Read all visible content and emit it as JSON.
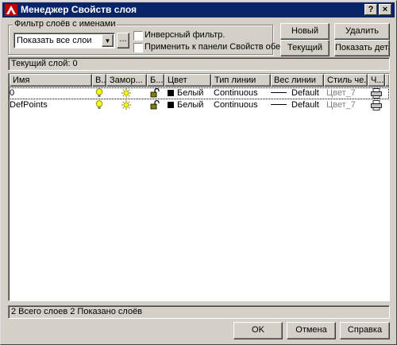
{
  "window": {
    "title": "Менеджер Свойств слоя",
    "help_button": "?",
    "close_button": "×"
  },
  "filter": {
    "group_label": "Фильтр слоёв с именами",
    "selected": "Показать все слои",
    "browse_label": "...",
    "inverse_label": "Инверсный фильтр.",
    "apply_label": "Применить к панели Свойств обекта."
  },
  "buttons": {
    "new": "Новый",
    "delete": "Удалить",
    "current": "Текущий",
    "show_details": "Показать детали"
  },
  "current_layer": "Текущий слой:  0",
  "table": {
    "columns": [
      "Имя",
      "В...",
      "Замор...",
      "Б...",
      "Цвет",
      "Тип линии",
      "Вес линии",
      "Стиль че...",
      "Ч..."
    ],
    "rows": [
      {
        "name": "0",
        "color": "Белый",
        "linetype": "Continuous",
        "lineweight": "Default",
        "plotstyle": "Цвет_7"
      },
      {
        "name": "DefPoints",
        "color": "Белый",
        "linetype": "Continuous",
        "lineweight": "Default",
        "plotstyle": "Цвет_7"
      }
    ]
  },
  "status": "2 Всего слоев   2 Показано слоёв",
  "footer": {
    "ok": "OK",
    "cancel": "Отмена",
    "help": "Справка"
  },
  "colors": {
    "titlebar": "#0a246a",
    "face": "#d4d0c8",
    "bulb": "#ffff00",
    "swatch": "#000000"
  }
}
